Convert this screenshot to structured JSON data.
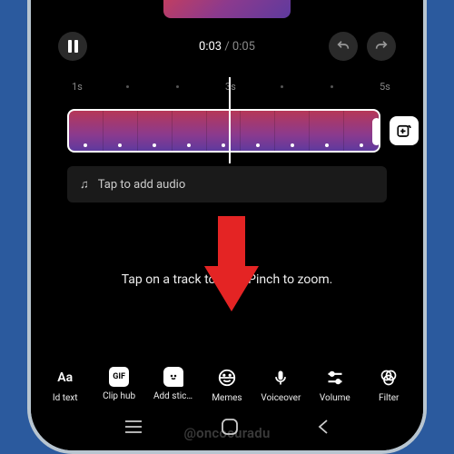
{
  "playback": {
    "current_time": "0:03",
    "total_time": "0:05"
  },
  "ruler": {
    "labels": [
      "1s",
      "3s",
      "5s"
    ]
  },
  "audio": {
    "placeholder": "Tap to add audio"
  },
  "hint": "Tap on a track to trim. Pinch to zoom.",
  "tools": [
    {
      "label": "Id text",
      "icon_text": "Aa"
    },
    {
      "label": "Clip hub",
      "icon_text": "GIF"
    },
    {
      "label": "Add stic…",
      "icon_text": ""
    },
    {
      "label": "Memes",
      "icon_text": ""
    },
    {
      "label": "Voiceover",
      "icon_text": ""
    },
    {
      "label": "Volume",
      "icon_text": ""
    },
    {
      "label": "Filter",
      "icon_text": ""
    }
  ],
  "watermark": "@oncocuradu",
  "colors": {
    "accent_arrow": "#e42424"
  }
}
